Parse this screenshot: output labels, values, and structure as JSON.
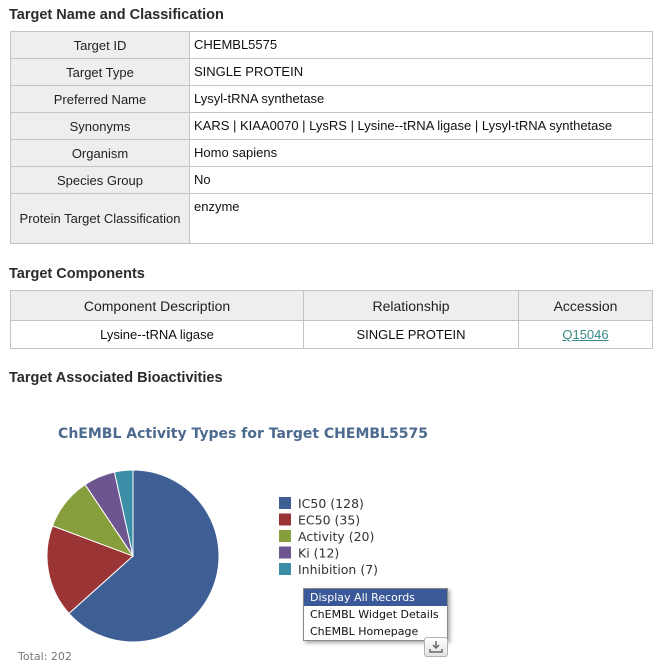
{
  "sections": {
    "classification_title": "Target Name and Classification",
    "components_title": "Target Components",
    "bioactivities_title": "Target Associated Bioactivities"
  },
  "classification": [
    {
      "label": "Target ID",
      "value": "CHEMBL5575"
    },
    {
      "label": "Target Type",
      "value": "SINGLE PROTEIN"
    },
    {
      "label": "Preferred Name",
      "value": "Lysyl-tRNA synthetase"
    },
    {
      "label": "Synonyms",
      "value": "KARS | KIAA0070 | LysRS | Lysine--tRNA ligase | Lysyl-tRNA synthetase"
    },
    {
      "label": "Organism",
      "value": "Homo sapiens"
    },
    {
      "label": "Species Group",
      "value": "No"
    },
    {
      "label": "Protein Target Classification",
      "value": "enzyme"
    }
  ],
  "components": {
    "headers": [
      "Component Description",
      "Relationship",
      "Accession"
    ],
    "rows": [
      {
        "description": "Lysine--tRNA ligase",
        "relationship": "SINGLE PROTEIN",
        "accession": "Q15046"
      }
    ]
  },
  "chart_data": {
    "type": "pie",
    "title": "ChEMBL Activity Types for Target CHEMBL5575",
    "total_label": "Total: 202",
    "legend_position": "right",
    "series": [
      {
        "name": "IC50 (128)",
        "category": "IC50",
        "value": 128,
        "color": "#3d5f94"
      },
      {
        "name": "EC50 (35)",
        "category": "EC50",
        "value": 35,
        "color": "#9b3434"
      },
      {
        "name": "Activity (20)",
        "category": "Activity",
        "value": 20,
        "color": "#869e3c"
      },
      {
        "name": "Ki (12)",
        "category": "Ki",
        "value": 12,
        "color": "#6d5690"
      },
      {
        "name": "Inhibition (7)",
        "category": "Inhibition",
        "value": 7,
        "color": "#3c8ea6"
      }
    ]
  },
  "context_menu": {
    "items": [
      "Display All Records",
      "ChEMBL Widget Details",
      "ChEMBL Homepage"
    ]
  },
  "icons": {
    "export": "download-icon"
  }
}
